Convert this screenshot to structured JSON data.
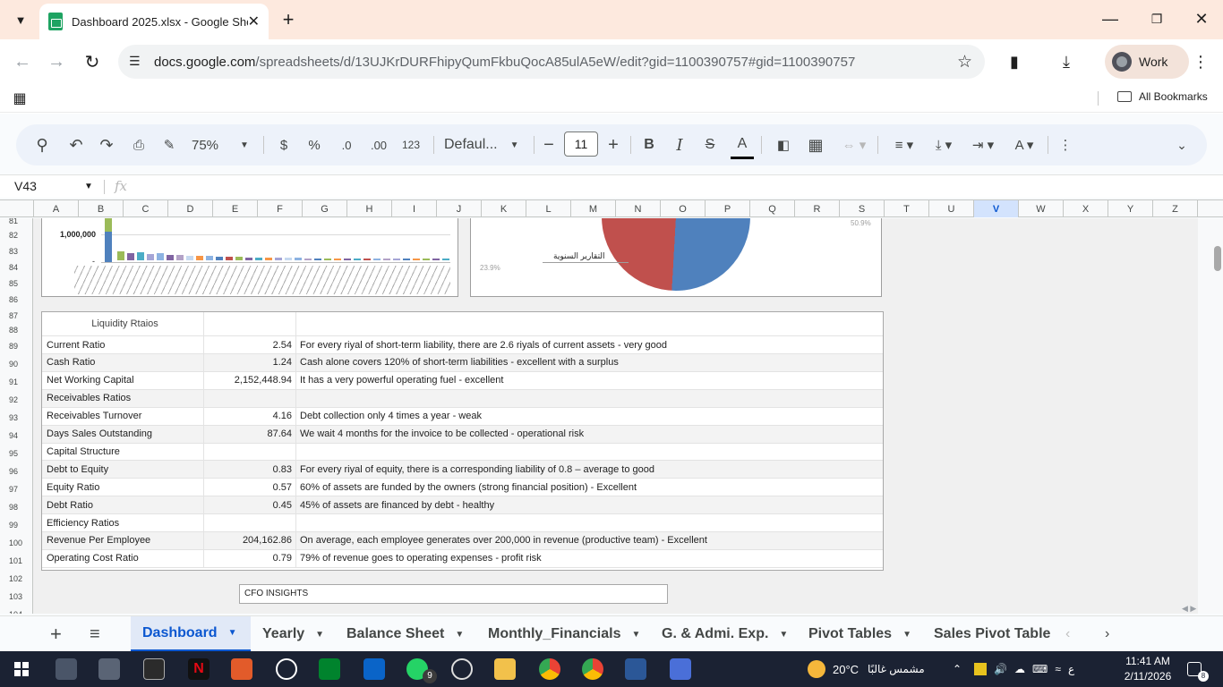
{
  "browser": {
    "tab_title": "Dashboard 2025.xlsx - Google She",
    "url_host": "docs.google.com",
    "url_path": "/spreadsheets/d/13UJKrDURFhipyQumFkbuQocA85ulA5eW/edit?gid=1100390757#gid=1100390757",
    "profile_label": "Work",
    "bookmarks_label": "All Bookmarks"
  },
  "toolbar": {
    "zoom": "75%",
    "currency": "$",
    "percent": "%",
    "dec_decrease": ".0",
    "dec_increase": ".00",
    "format_123": "123",
    "font": "Defaul...",
    "font_size": "11"
  },
  "formula_bar": {
    "cell_ref": "V43",
    "fx": "fx"
  },
  "columns": [
    "A",
    "B",
    "C",
    "D",
    "E",
    "F",
    "G",
    "H",
    "I",
    "J",
    "K",
    "L",
    "M",
    "N",
    "O",
    "P",
    "Q",
    "R",
    "S",
    "T",
    "U",
    "V",
    "W",
    "X",
    "Y",
    "Z"
  ],
  "selected_column": "V",
  "rows": [
    "81",
    "82",
    "83",
    "84",
    "85",
    "86",
    "87",
    "88",
    "89",
    "90",
    "91",
    "92",
    "93",
    "94",
    "95",
    "96",
    "97",
    "98",
    "99",
    "100",
    "101",
    "102",
    "103",
    "104",
    "105",
    "106"
  ],
  "bar_chart": {
    "y_tick_top": "1,000,000",
    "y_tick_bottom": "-"
  },
  "pie_chart": {
    "label": "التقارير السنوية",
    "pct_left": "23.9%",
    "pct_right": "50.9%"
  },
  "ratios_table": {
    "header": "Liquidity Rtaios",
    "rows": [
      {
        "name": "Current Ratio",
        "value": "2.54",
        "desc": "For every riyal of short-term liability, there are 2.6 riyals of current assets - very good"
      },
      {
        "name": "Cash Ratio",
        "value": "1.24",
        "desc": "Cash alone covers 120% of short-term liabilities - excellent with a surplus"
      },
      {
        "name": "Net Working Capital",
        "value": "2,152,448.94",
        "desc": "It has a very powerful operating fuel - excellent"
      },
      {
        "name": "Receivables Ratios",
        "value": "",
        "desc": ""
      },
      {
        "name": "Receivables Turnover",
        "value": "4.16",
        "desc": "Debt collection only 4 times a year -  weak"
      },
      {
        "name": "Days Sales Outstanding",
        "value": "87.64",
        "desc": "We wait 4 months for the invoice to be collected - operational risk"
      },
      {
        "name": "Capital Structure",
        "value": "",
        "desc": ""
      },
      {
        "name": "Debt to Equity",
        "value": "0.83",
        "desc": "For every riyal of equity, there is a corresponding liability of 0.8 – average to good"
      },
      {
        "name": "Equity Ratio",
        "value": "0.57",
        "desc": "60% of assets are funded by the owners (strong financial position) - Excellent"
      },
      {
        "name": "Debt Ratio",
        "value": "0.45",
        "desc": "45% of assets are financed by debt - healthy"
      },
      {
        "name": "Efficiency Ratios",
        "value": "",
        "desc": ""
      },
      {
        "name": "Revenue Per Employee",
        "value": "204,162.86",
        "desc": "On average, each employee generates over 200,000 in revenue (productive team) - Excellent"
      },
      {
        "name": "Operating Cost Ratio",
        "value": "0.79",
        "desc": "79% of revenue goes to operating expenses - profit risk"
      }
    ]
  },
  "cfo_label": "CFO INSIGHTS",
  "sheet_tabs": [
    "Dashboard",
    "Yearly",
    "Balance Sheet",
    "Monthly_Financials",
    "G. & Admi. Exp.",
    "Pivot Tables",
    "Sales Pivot Table"
  ],
  "taskbar": {
    "weather": "20°C",
    "weather_text": "مشمس غالبًا",
    "time": "11:41 AM",
    "date": "2/11/2026",
    "lang": "ع",
    "whatsapp_badge": "9",
    "notif_count": "8"
  },
  "colors": {
    "sheets_green": "#1ea362",
    "active_tab_blue": "#0b57d0",
    "pie_red": "#c0504d",
    "pie_blue": "#4f81bd"
  }
}
